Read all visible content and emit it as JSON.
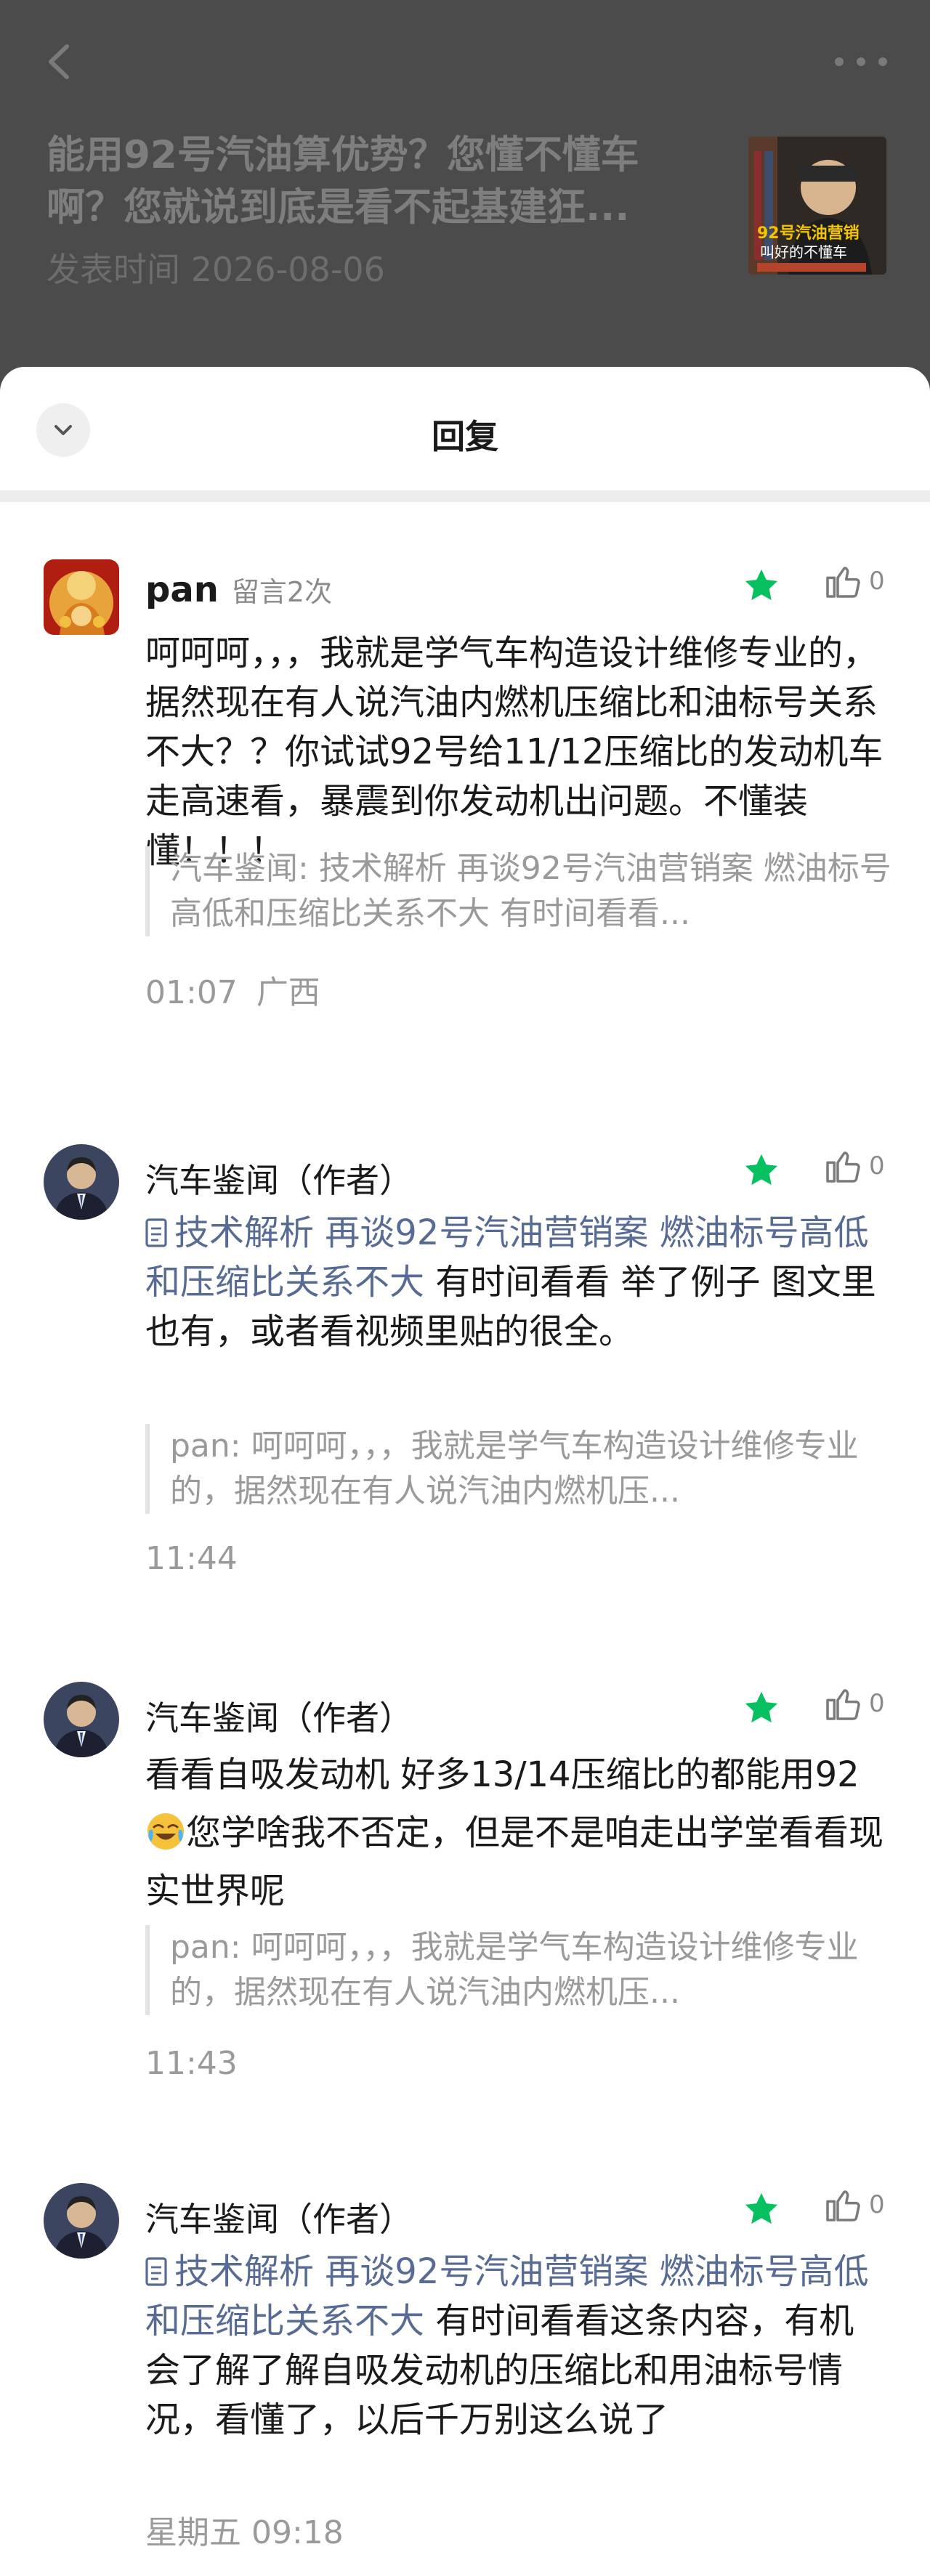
{
  "header": {
    "article_title": "能用92号汽油算优势？您懂不懂车啊？您就说到底是看不起基建狂...",
    "publish_date": "发表时间 2026-08-06",
    "thumbnail_caption_1": "92号汽油营销",
    "thumbnail_caption_2": "叫好的不懂车"
  },
  "sheet": {
    "title": "回复"
  },
  "comments": [
    {
      "name": "pan",
      "count_badge": "留言2次",
      "likes": "0",
      "body": "呵呵呵，，，我就是学气车构造设计维修专业的，据然现在有人说汽油内燃机压缩比和油标号关系不大？？你试试92号给11/12压缩比的发动机车走高速看，暴震到你发动机出问题。不懂装懂！！！",
      "quote": "汽车鉴闻: 技术解析 再谈92号汽油营销案 燃油标号高低和压缩比关系不大 有时间看看...",
      "time": "01:07",
      "location": "广西"
    },
    {
      "name": "汽车鉴闻（作者）",
      "likes": "0",
      "link_text": "技术解析 再谈92号汽油营销案 燃油标号高低和压缩比关系不大",
      "body": " 有时间看看 举了例子 图文里也有，或者看视频里贴的很全。",
      "quote": "pan: 呵呵呵，，，我就是学气车构造设计维修专业的，据然现在有人说汽油内燃机压...",
      "time": "11:44"
    },
    {
      "name": "汽车鉴闻（作者）",
      "likes": "0",
      "body_part1": "看看自吸发动机 好多13/14压缩比的都能用92",
      "body_part2": "您学啥我不否定，但是不是咱走出学堂看看现实世界呢",
      "quote": "pan: 呵呵呵，，，我就是学气车构造设计维修专业的，据然现在有人说汽油内燃机压...",
      "time": "11:43"
    },
    {
      "name": "汽车鉴闻（作者）",
      "likes": "0",
      "link_text": "技术解析 再谈92号汽油营销案 燃油标号高低和压缩比关系不大",
      "body": " 有时间看看这条内容，有机会了解了解自吸发动机的压缩比和用油标号情况，看懂了，以后千万别这么说了",
      "time": "星期五  09:18"
    }
  ],
  "colors": {
    "link": "#576b95",
    "star": "#07c160",
    "overlay": "#4b4b4b"
  },
  "icons": [
    "back-arrow-icon",
    "more-icon",
    "chevron-down-icon",
    "star-icon",
    "thumbs-up-icon",
    "document-icon",
    "crying-laughing-emoji-icon"
  ]
}
